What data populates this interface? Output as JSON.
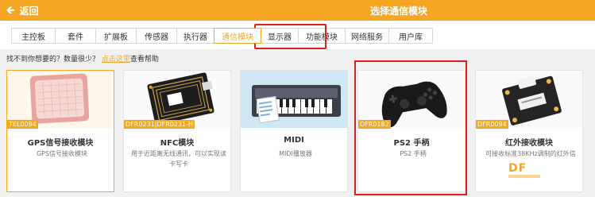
{
  "header": {
    "back_label": "返回",
    "title": "选择通信模块",
    "accent_color": "#f5a623"
  },
  "tabs": [
    {
      "label": "主控板"
    },
    {
      "label": "套件"
    },
    {
      "label": "扩展板"
    },
    {
      "label": "传感器"
    },
    {
      "label": "执行器"
    },
    {
      "label": "通信模块",
      "active": true
    },
    {
      "label": "显示器"
    },
    {
      "label": "功能模块"
    },
    {
      "label": "网络服务"
    },
    {
      "label": "用户库"
    }
  ],
  "hint": {
    "text": "找不到你想要的？数量很少？",
    "link": "点击这里",
    "suffix": "查看帮助"
  },
  "cards": [
    {
      "sku": "TEL0094",
      "name": "GPS信号接收模块",
      "desc": "GPS信号接收模块"
    },
    {
      "sku": "DFR0231|DFR0231-H",
      "name": "NFC模块",
      "desc": "用于近距离无线通讯，可以实现读卡写卡"
    },
    {
      "sku": "",
      "name": "MIDI",
      "desc": "MIDI播放器"
    },
    {
      "sku": "DFR0182",
      "name": "PS2 手柄",
      "desc": "PS2 手柄"
    },
    {
      "sku": "DFR0094",
      "name": "红外接收模块",
      "desc": "可接收标准38KHz调制的红外信"
    }
  ],
  "watermark": "DF"
}
